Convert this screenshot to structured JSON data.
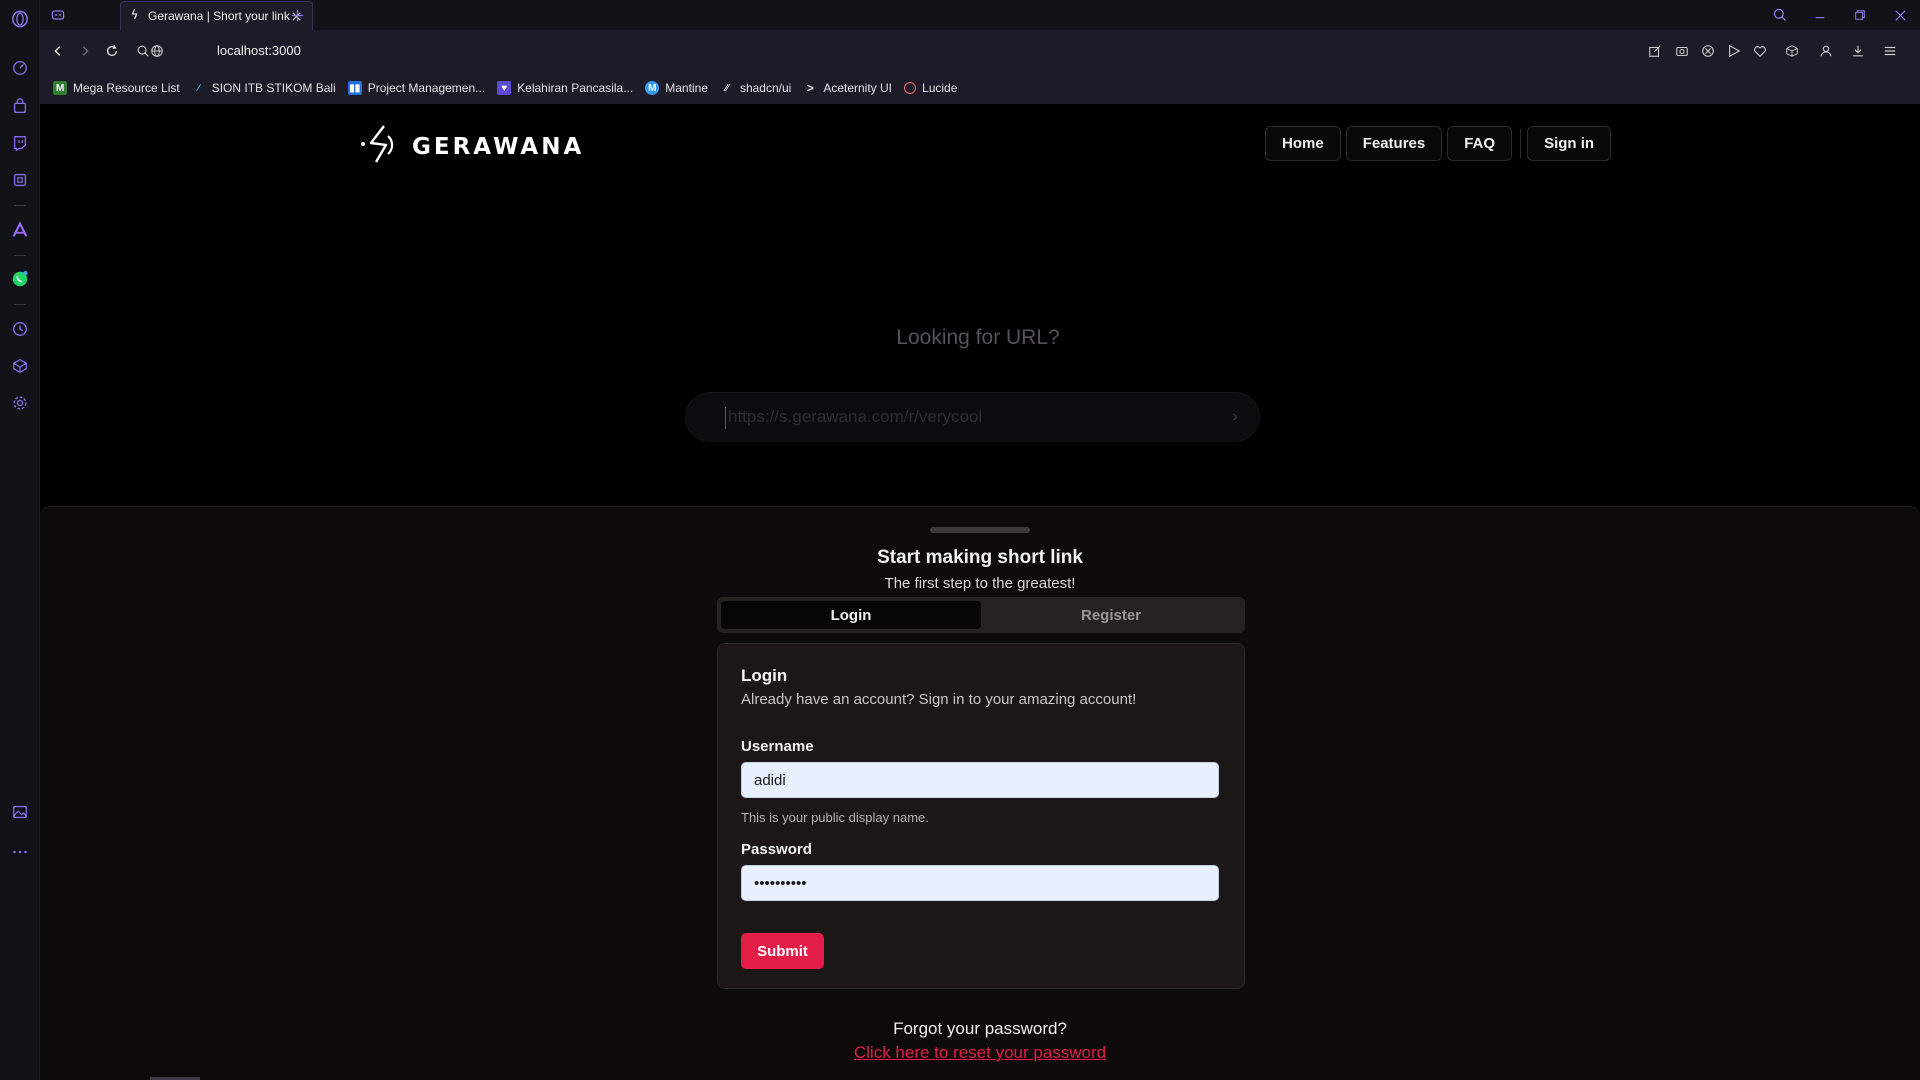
{
  "browser": {
    "tab": {
      "title": "Gerawana | Short your link"
    },
    "address": {
      "url": "localhost:3000"
    },
    "bookmarks": [
      {
        "label": "Mega Resource List",
        "icon": "mega-resource-icon",
        "color": "#2e7d32"
      },
      {
        "label": "SION ITB STIKOM Bali",
        "icon": "sion-icon",
        "color": "#1565c0"
      },
      {
        "label": "Project Managemen...",
        "icon": "trello-icon",
        "color": "#1e6fe0"
      },
      {
        "label": "Kelahiran Pancasila...",
        "icon": "shield-badge-icon",
        "color": "#5b4bd6"
      },
      {
        "label": "Mantine",
        "icon": "mantine-icon",
        "color": "#339af0"
      },
      {
        "label": "shadcn/ui",
        "icon": "shadcn-icon",
        "color": "#3a3a3a"
      },
      {
        "label": "Aceternity UI",
        "icon": "aceternity-icon",
        "color": "#1d1b27"
      },
      {
        "label": "Lucide",
        "icon": "lucide-icon",
        "color": "#f56565"
      }
    ]
  },
  "site": {
    "logo_text": "GERAWANA",
    "nav": {
      "home": "Home",
      "features": "Features",
      "faq": "FAQ",
      "signin": "Sign in"
    },
    "hero": {
      "title": "Looking for URL?",
      "placeholder": "https://s.gerawana.com/r/verycool"
    },
    "drawer": {
      "title": "Start making short link",
      "subtitle": "The first step to the greatest!",
      "tabs": {
        "login": "Login",
        "register": "Register"
      },
      "card": {
        "title": "Login",
        "description": "Already have an account? Sign in to your amazing account!",
        "username_label": "Username",
        "username_value": "adidi",
        "username_hint": "This is your public display name.",
        "password_label": "Password",
        "password_value": "••••••••••",
        "submit": "Submit"
      },
      "forgot_text": "Forgot your password?",
      "reset_link": "Click here to reset your password"
    }
  },
  "colors": {
    "accent": "#e11d48",
    "browser_accent": "#7c5cff",
    "page_bg": "#000000"
  }
}
